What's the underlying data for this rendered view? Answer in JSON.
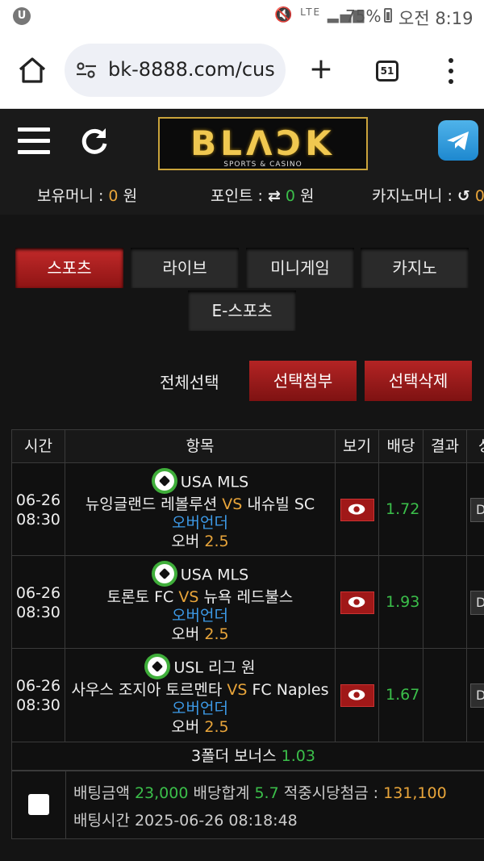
{
  "status_bar": {
    "battery": "75%",
    "time": "오전 8:19",
    "network": "LTE",
    "app_badge": "U"
  },
  "browser": {
    "url": "bk-8888.com/cus",
    "tab_count": "51",
    "icons": [
      "home-icon",
      "tune-icon",
      "plus-icon",
      "tabs-icon",
      "more-vert-icon"
    ]
  },
  "header": {
    "logo_text": "BLΛƆK",
    "logo_sub": "SPORTS & CASINO",
    "wallet": {
      "money_label": "보유머니 :",
      "money_value": "0",
      "money_unit": "원",
      "points_label": "포인트 :",
      "points_value": "0",
      "points_unit": "원",
      "casino_label": "카지노머니 :",
      "casino_value": "0"
    }
  },
  "categories": [
    {
      "label": "스포츠",
      "active": true
    },
    {
      "label": "라이브",
      "active": false
    },
    {
      "label": "미니게임",
      "active": false
    },
    {
      "label": "카지노",
      "active": false
    },
    {
      "label": "E-스포츠",
      "active": false
    }
  ],
  "actions": {
    "select_all": "전체선택",
    "attach_selected": "선택첨부",
    "delete_selected": "선택삭제"
  },
  "table": {
    "headers": [
      "시간",
      "항목",
      "보기",
      "배당",
      "결과",
      "상"
    ],
    "rows": [
      {
        "date": "06-26",
        "time": "08:30",
        "league": "USA MLS",
        "home": "뉴잉글랜드 레볼루션",
        "vs": "VS",
        "away": "내슈빌 SC",
        "market": "오버언더",
        "pick": "오버",
        "line": "2.5",
        "odds": "1.72",
        "status_btn": "D"
      },
      {
        "date": "06-26",
        "time": "08:30",
        "league": "USA MLS",
        "home": "토론토 FC",
        "vs": "VS",
        "away": "뉴욕 레드불스",
        "market": "오버언더",
        "pick": "오버",
        "line": "2.5",
        "odds": "1.93",
        "status_btn": "D"
      },
      {
        "date": "06-26",
        "time": "08:30",
        "league": "USL 리그 원",
        "home": "사우스 조지아 토르멘타",
        "vs": "VS",
        "away": "FC Naples",
        "market": "오버언더",
        "pick": "오버",
        "line": "2.5",
        "odds": "1.67",
        "status_btn": "D"
      }
    ],
    "bonus_label": "3폴더 보너스",
    "bonus_value": "1.03"
  },
  "summary": {
    "bet_amount_label": "배팅금액",
    "bet_amount": "23,000",
    "odds_total_label": "배당합계",
    "odds_total": "5.7",
    "payout_label": "적중시당첨금 :",
    "payout": "131,100",
    "bet_time_label": "배팅시간",
    "bet_time": "2025-06-26 08:18:48"
  }
}
